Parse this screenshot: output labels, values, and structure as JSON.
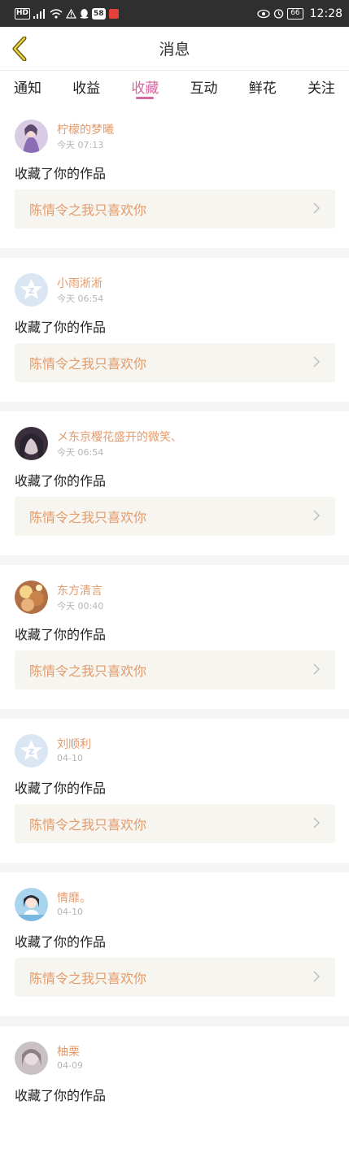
{
  "status_bar": {
    "left_icons": [
      "hd-icon",
      "signal-icon",
      "wifi-icon",
      "warning-icon",
      "qq-icon",
      "app58-icon",
      "red-app-icon"
    ],
    "hd": "HD",
    "badge58": "58",
    "battery": "66",
    "time": "12:28"
  },
  "header": {
    "title": "消息"
  },
  "tabs": [
    {
      "label": "通知",
      "active": false
    },
    {
      "label": "收益",
      "active": false
    },
    {
      "label": "收藏",
      "active": true
    },
    {
      "label": "互动",
      "active": false
    },
    {
      "label": "鲜花",
      "active": false
    },
    {
      "label": "关注",
      "active": false
    }
  ],
  "notifications": [
    {
      "user": "柠檬的梦曦",
      "time": "今天 07:13",
      "action": "收藏了你的作品",
      "work": "陈情令之我只喜欢你",
      "avatar": "photo-purple"
    },
    {
      "user": "小雨淅淅",
      "time": "今天 06:54",
      "action": "收藏了你的作品",
      "work": "陈情令之我只喜欢你",
      "avatar": "default"
    },
    {
      "user": "メ东京樱花盛开的微笑、",
      "time": "今天 06:54",
      "action": "收藏了你的作品",
      "work": "陈情令之我只喜欢你",
      "avatar": "photo-dark"
    },
    {
      "user": "东方清言",
      "time": "今天 00:40",
      "action": "收藏了你的作品",
      "work": "陈情令之我只喜欢你",
      "avatar": "photo-warm"
    },
    {
      "user": "刘顺利",
      "time": "04-10",
      "action": "收藏了你的作品",
      "work": "陈情令之我只喜欢你",
      "avatar": "default"
    },
    {
      "user": "情靡。",
      "time": "04-10",
      "action": "收藏了你的作品",
      "work": "陈情令之我只喜欢你",
      "avatar": "photo-blue"
    },
    {
      "user": "柚栗",
      "time": "04-09",
      "action": "收藏了你的作品",
      "work": "",
      "avatar": "photo-pale"
    }
  ],
  "colors": {
    "accent": "#d6679e",
    "name": "#e49a6a",
    "card_bg": "#f6f5ef",
    "separator": "#f5f5f5"
  }
}
